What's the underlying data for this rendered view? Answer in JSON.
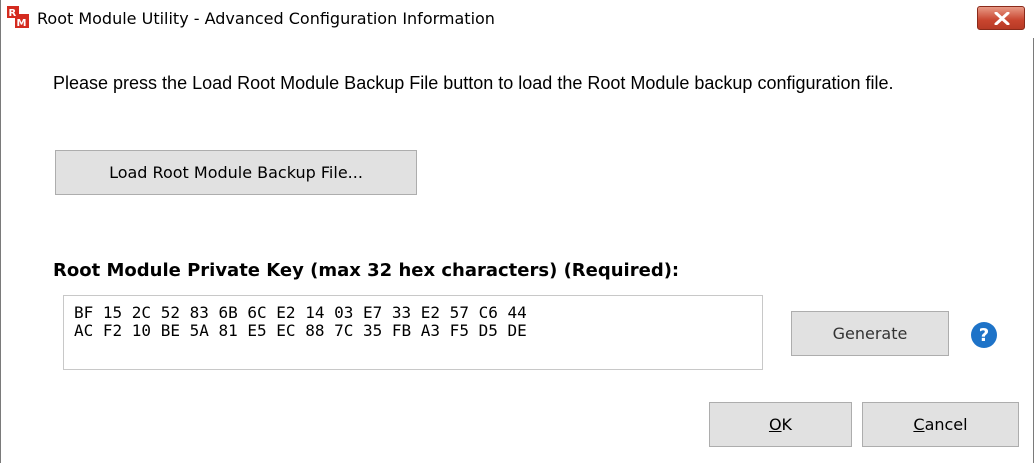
{
  "window": {
    "title": "Root Module Utility - Advanced Configuration Information",
    "app_icon": "rm-logo-icon",
    "close_icon": "close-icon"
  },
  "main": {
    "instruction": "Please press the Load Root Module Backup File button to load the Root Module backup configuration file.",
    "load_button_label": "Load Root Module Backup File...",
    "key_label": "Root Module Private Key (max 32 hex characters) (Required):",
    "key_value": "BF 15 2C 52 83 6B 6C E2 14 03 E7 33 E2 57 C6 44\nAC F2 10 BE 5A 81 E5 EC 88 7C 35 FB A3 F5 D5 DE",
    "generate_label": "Generate",
    "help_glyph": "?"
  },
  "footer": {
    "ok_mnemonic": "O",
    "ok_rest": "K",
    "cancel_mnemonic": "C",
    "cancel_rest": "ancel"
  },
  "colors": {
    "close_button": "#c8452f",
    "help_icon": "#1e73c8",
    "button_face": "#e1e1e1"
  }
}
